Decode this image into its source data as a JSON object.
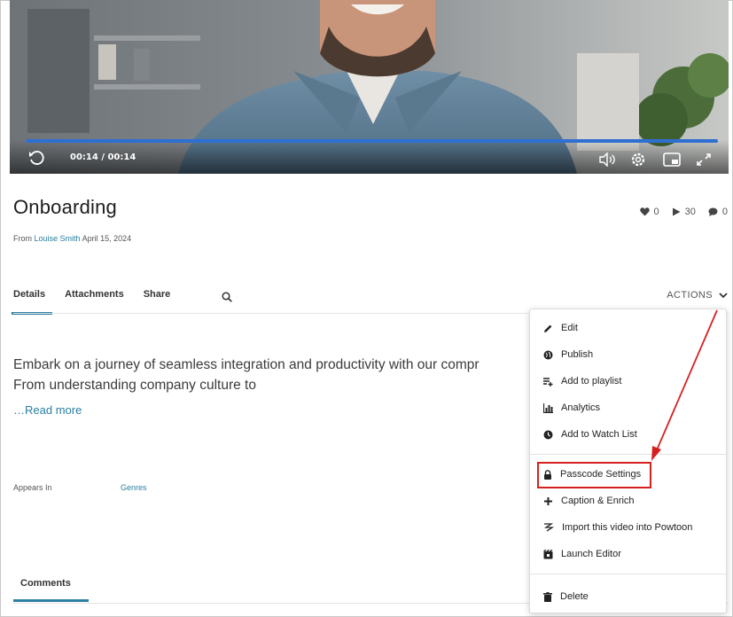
{
  "player": {
    "time_display": "00:14 / 00:14",
    "progress": 1.0
  },
  "video": {
    "title": "Onboarding",
    "from_prefix": "From",
    "author": "Louise Smith",
    "date": "April 15, 2024",
    "likes": "0",
    "plays": "30",
    "comments": "0"
  },
  "tabs": [
    "Details",
    "Attachments",
    "Share"
  ],
  "actions_label": "ACTIONS",
  "description": {
    "line1": "Embark on a journey of seamless integration and productivity with our compr",
    "line2": "From understanding company culture to",
    "read_more": "…Read more"
  },
  "appears_in": {
    "label": "Appears In",
    "value": "Genres"
  },
  "comments_tab": "Comments",
  "menu": {
    "edit": "Edit",
    "publish": "Publish",
    "add_to_playlist": "Add to playlist",
    "analytics": "Analytics",
    "add_to_watch_list": "Add to Watch List",
    "passcode_settings": "Passcode Settings",
    "caption_enrich": "Caption & Enrich",
    "import_powtoon": "Import this video into Powtoon",
    "launch_editor": "Launch Editor",
    "delete": "Delete"
  },
  "colors": {
    "accent": "#2d7fa3",
    "link": "#2a7fa3",
    "progress": "#2f6fd1",
    "annotation": "#d62020"
  }
}
